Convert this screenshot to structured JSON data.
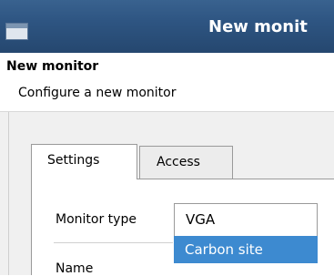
{
  "window": {
    "title": "New monit"
  },
  "header": {
    "title": "New monitor",
    "subtitle": "Configure a new monitor"
  },
  "tabs": [
    {
      "label": "Settings"
    },
    {
      "label": "Access"
    }
  ],
  "form": {
    "monitor_type_label": "Monitor type",
    "monitor_type_value": "VGA",
    "dropdown_options": [
      "Carbon site"
    ],
    "name_label": "Name"
  }
}
